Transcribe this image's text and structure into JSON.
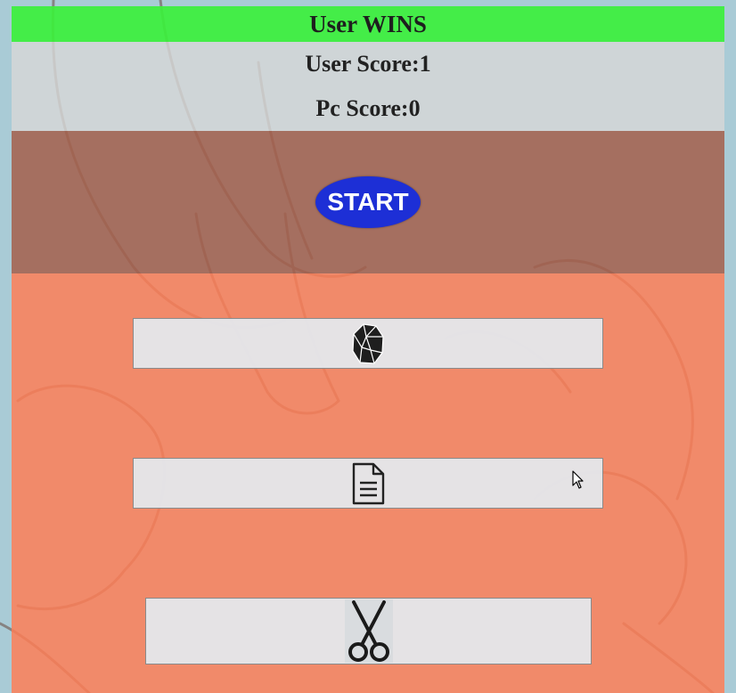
{
  "result": {
    "text": "User WINS"
  },
  "scores": {
    "user": "User Score:1",
    "pc": "Pc Score:0"
  },
  "controls": {
    "start_label": "START"
  },
  "choices": [
    {
      "icon": "rock-icon"
    },
    {
      "icon": "paper-document-icon"
    },
    {
      "icon": "scissors-icon"
    }
  ],
  "colors": {
    "result_bar": "#3cf03c",
    "start_button": "#1d2fd6",
    "choices_background": "#ff7d55",
    "start_panel": "#a55f4b",
    "page_background": "#a9cbd6"
  }
}
